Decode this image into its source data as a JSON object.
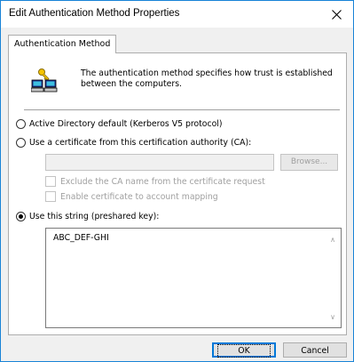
{
  "window": {
    "title": "Edit Authentication Method Properties"
  },
  "tab": {
    "label": "Authentication Method"
  },
  "description": "The authentication method specifies how trust is established between the computers.",
  "options": {
    "active_directory": {
      "label": "Active Directory default (Kerberos V5 protocol)",
      "selected": false
    },
    "certificate": {
      "label": "Use a certificate from this certification authority (CA):",
      "selected": false
    },
    "preshared": {
      "label": "Use this string (preshared key):",
      "selected": true
    }
  },
  "certificate": {
    "value": "",
    "browse_label": "Browse...",
    "exclude_label": "Exclude the CA name from the certificate request",
    "mapping_label": "Enable certificate to account mapping"
  },
  "preshared_key": {
    "value": "ABC_DEF-GHI"
  },
  "buttons": {
    "ok": "OK",
    "cancel": "Cancel"
  },
  "colors": {
    "accent": "#0078d7",
    "border": "#1883d7"
  },
  "icons": {
    "close": "close-icon",
    "auth": "computers-key-icon"
  }
}
